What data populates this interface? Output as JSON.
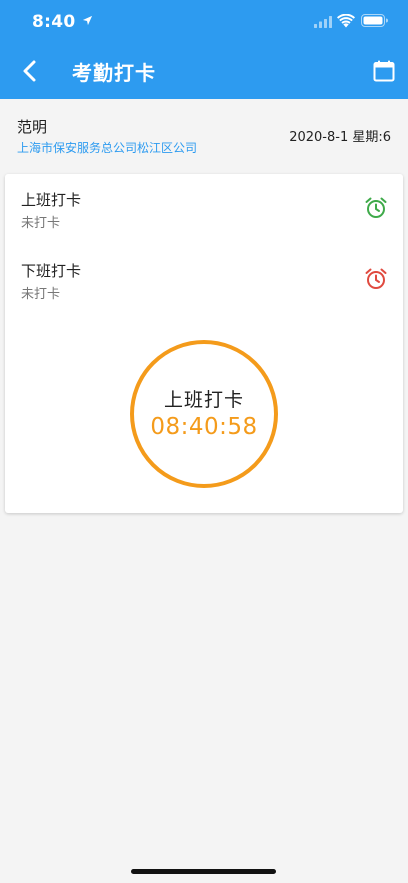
{
  "status_bar": {
    "time": "8:40"
  },
  "app_bar": {
    "title": "考勤打卡"
  },
  "user": {
    "name": "范明",
    "company": "上海市保安服务总公司松江区公司",
    "date": "2020-8-1 星期:6"
  },
  "records": [
    {
      "label": "上班打卡",
      "status": "未打卡",
      "icon": "alarm-clock-icon",
      "color": "#3faa4a"
    },
    {
      "label": "下班打卡",
      "status": "未打卡",
      "icon": "alarm-clock-icon",
      "color": "#e04a3f"
    }
  ],
  "punch": {
    "label": "上班打卡",
    "time": "08:40:58",
    "color": "#f49b1b"
  },
  "colors": {
    "primary": "#2d9bf0",
    "accent": "#f49b1b"
  }
}
